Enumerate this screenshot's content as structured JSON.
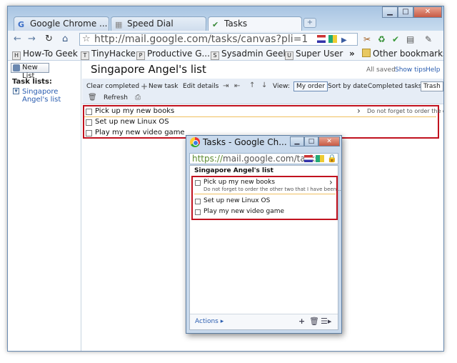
{
  "browser": {
    "tabs": [
      {
        "label": "Google Chrome ...",
        "icon": "G"
      },
      {
        "label": "Speed Dial",
        "icon": "▦"
      },
      {
        "label": "Tasks",
        "icon": "✔"
      }
    ],
    "new_tab": "+",
    "window_buttons": {
      "minimize": "▁",
      "maximize": "□",
      "close": "✕"
    },
    "nav": {
      "back": "←",
      "forward": "→",
      "reload": "↻",
      "home": "⌂"
    },
    "url": "http://mail.google.com/tasks/canvas?pli=1",
    "star": "☆",
    "toolbar_icons": {
      "play": "▶",
      "ext1": "✂",
      "ext2": "♻",
      "check": "✔",
      "page": "▤",
      "wrench": "✎"
    },
    "bookmarks": [
      {
        "label": "How-To Geek",
        "icon": "H"
      },
      {
        "label": "TinyHacker",
        "icon": "T"
      },
      {
        "label": "Productive G...",
        "icon": "P"
      },
      {
        "label": "Sysadmin Geek",
        "icon": "S"
      },
      {
        "label": "Super User",
        "icon": "U"
      }
    ],
    "bookmarks_more": "»",
    "other_bookmarks": "Other bookmarks"
  },
  "tasks_app": {
    "new_list": "New List",
    "task_lists_title": "Task lists:",
    "list_name": "Singapore Angel's list",
    "header_title": "Singapore Angel's list",
    "status": {
      "saved": "All saved",
      "show_tips": "Show tips",
      "help": "Help"
    },
    "actions": {
      "clear_completed": "Clear completed",
      "new_task": "New task",
      "edit_details": "Edit details",
      "view_label": "View:",
      "my_order": "My order",
      "sort_by_date": "Sort by date",
      "completed_tasks": "Completed tasks",
      "trash": "Trash",
      "refresh": "Refresh"
    },
    "tasks": [
      {
        "title": "Pick up my new books",
        "note": "Do not forget to order the other ..."
      },
      {
        "title": "Set up new Linux OS"
      },
      {
        "title": "Play my new video game"
      }
    ]
  },
  "popup": {
    "title": "Tasks - Google Ch...",
    "url_green": "https://",
    "url_rest": "mail.google.com/tasks",
    "list_title": "Singapore Angel's list",
    "tasks": [
      {
        "title": "Pick up my new books",
        "note": "Do not forget to order the other two that I have been..."
      },
      {
        "title": "Set up new Linux OS"
      },
      {
        "title": "Play my new video game"
      }
    ],
    "actions_label": "Actions ▸",
    "footer_icons": {
      "add": "+",
      "trash": "🗑",
      "list": "☰▸"
    }
  },
  "colors": {
    "highlight": "#c1121f",
    "link": "#2a5db0"
  }
}
